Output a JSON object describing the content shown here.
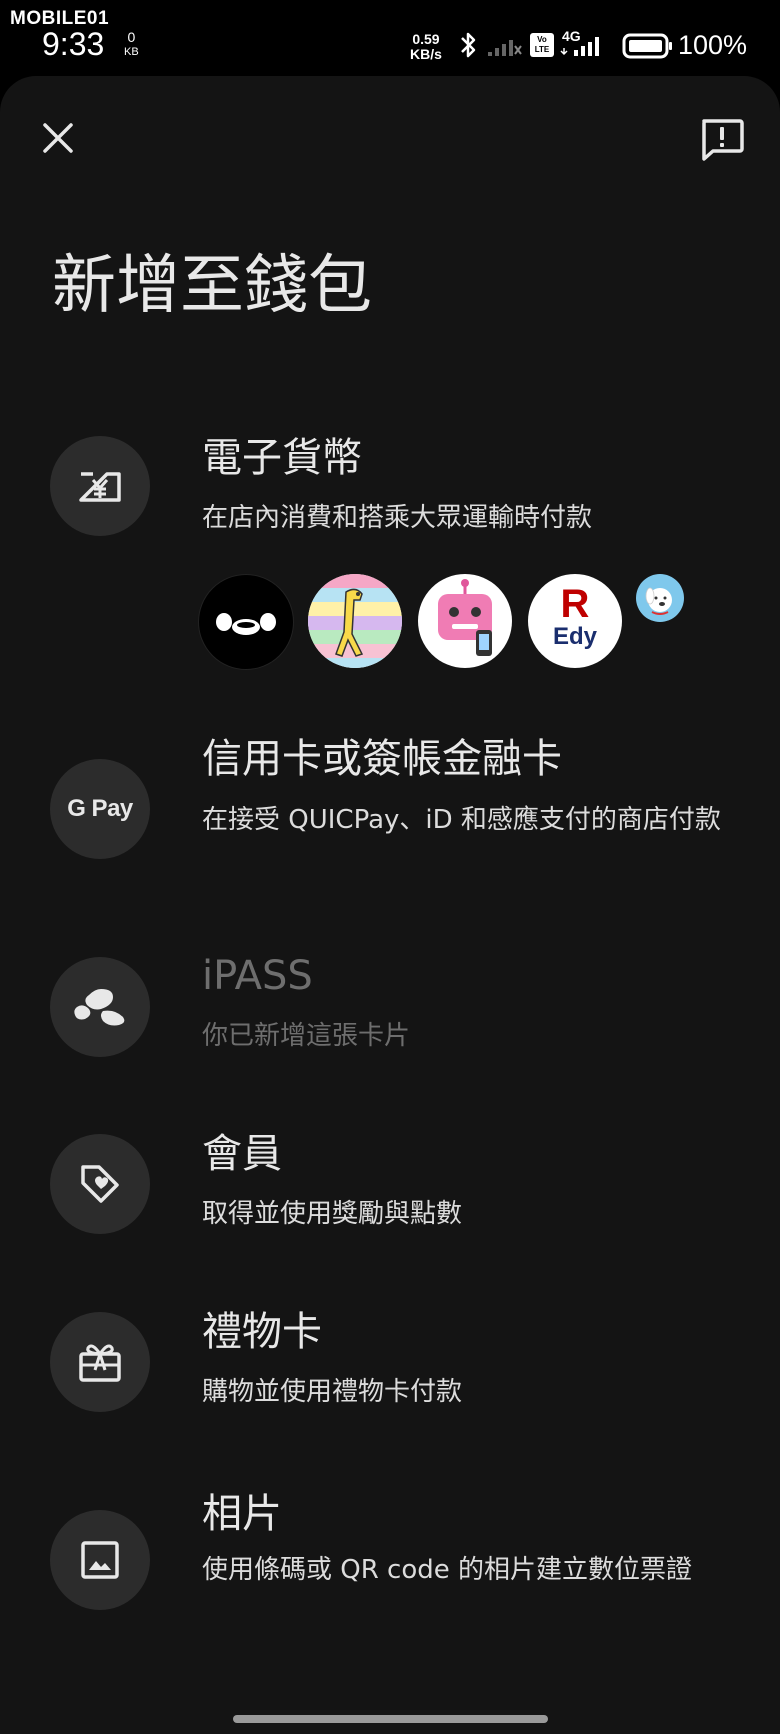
{
  "status_bar": {
    "brand": "MOBILE01",
    "time": "9:33",
    "kb_value": "0",
    "kb_unit": "KB",
    "net_speed_value": "0.59",
    "net_speed_unit": "KB/s",
    "network_type": "4G",
    "volte_label": "Vo LTE",
    "battery_percent": "100%",
    "icons": [
      "bluetooth-icon",
      "signal-icon",
      "volte-icon",
      "signal-4g-icon",
      "battery-icon"
    ]
  },
  "header": {
    "close_icon": "close-icon",
    "feedback_icon": "feedback-icon",
    "title": "新增至錢包"
  },
  "options": [
    {
      "id": "emoney",
      "icon": "yen-ticket-icon",
      "title": "電子貨幣",
      "subtitle": "在店內消費和搭乘大眾運輸時付款",
      "enabled": true,
      "logos": [
        {
          "name": "suica-logo"
        },
        {
          "name": "nanaco-logo"
        },
        {
          "name": "waon-robot-logo"
        },
        {
          "name": "rakuten-edy-logo",
          "text_top": "R",
          "text_bottom": "Edy"
        },
        {
          "name": "waon-dog-logo"
        }
      ]
    },
    {
      "id": "credit",
      "icon": "gpay-icon",
      "icon_text": "G Pay",
      "title": "信用卡或簽帳金融卡",
      "subtitle": "在接受 QUICPay、iD 和感應支付的商店付款",
      "enabled": true
    },
    {
      "id": "ipass",
      "icon": "ipass-icon",
      "title": "iPASS",
      "subtitle": "你已新增這張卡片",
      "enabled": false
    },
    {
      "id": "loyalty",
      "icon": "heart-tag-icon",
      "title": "會員",
      "subtitle": "取得並使用獎勵與點數",
      "enabled": true
    },
    {
      "id": "giftcard",
      "icon": "gift-card-icon",
      "title": "禮物卡",
      "subtitle": "購物並使用禮物卡付款",
      "enabled": true
    },
    {
      "id": "photo",
      "icon": "image-icon",
      "title": "相片",
      "subtitle": "使用條碼或 QR code 的相片建立數位票證",
      "enabled": true
    }
  ],
  "colors": {
    "background": "#141414",
    "icon_circle": "#2c2c2c",
    "text": "#e8e8e8",
    "disabled_text": "#6e6e6e"
  }
}
